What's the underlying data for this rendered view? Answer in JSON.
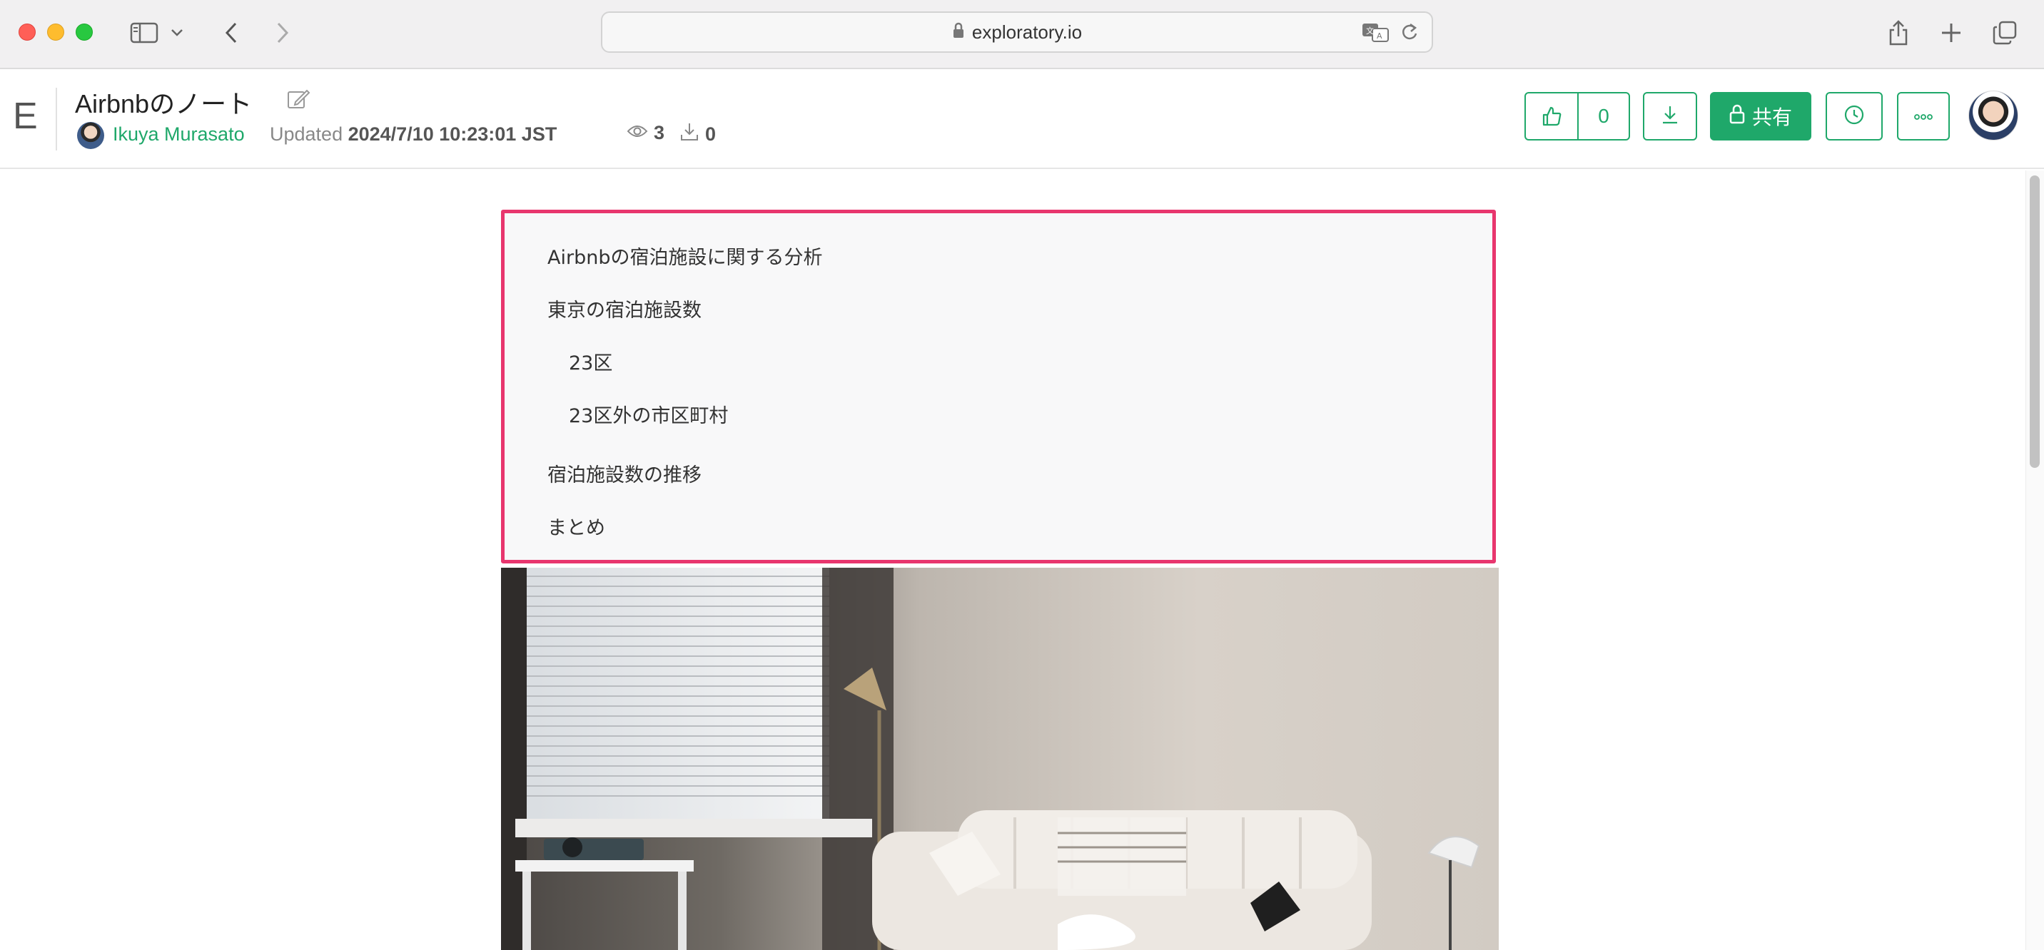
{
  "browser": {
    "url": "exploratory.io",
    "icons": [
      "sidebar-icon",
      "chevron-down-icon",
      "back-icon",
      "forward-icon",
      "lock-icon",
      "translate-icon",
      "reload-icon",
      "share-icon",
      "new-tab-icon",
      "tabs-overview-icon"
    ]
  },
  "header": {
    "logo": "E",
    "title": "Airbnbのノート",
    "author": "Ikuya Murasato",
    "updated_label": "Updated",
    "updated_value": "2024/7/10 10:23:01 JST",
    "views": "3",
    "downloads": "0",
    "like_count": "0",
    "share_label": "共有"
  },
  "toc": {
    "items": [
      {
        "label": "Airbnbの宿泊施設に関する分析",
        "level": 1
      },
      {
        "label": "東京の宿泊施設数",
        "level": 1
      },
      {
        "label": "23区",
        "level": 2
      },
      {
        "label": "23区外の市区町村",
        "level": 2
      },
      {
        "label": "宿泊施設数の推移",
        "level": 1
      },
      {
        "label": "まとめ",
        "level": 1
      }
    ],
    "border_color": "#e8366e"
  },
  "colors": {
    "accent": "#1fa86a",
    "highlight": "#e8366e"
  }
}
